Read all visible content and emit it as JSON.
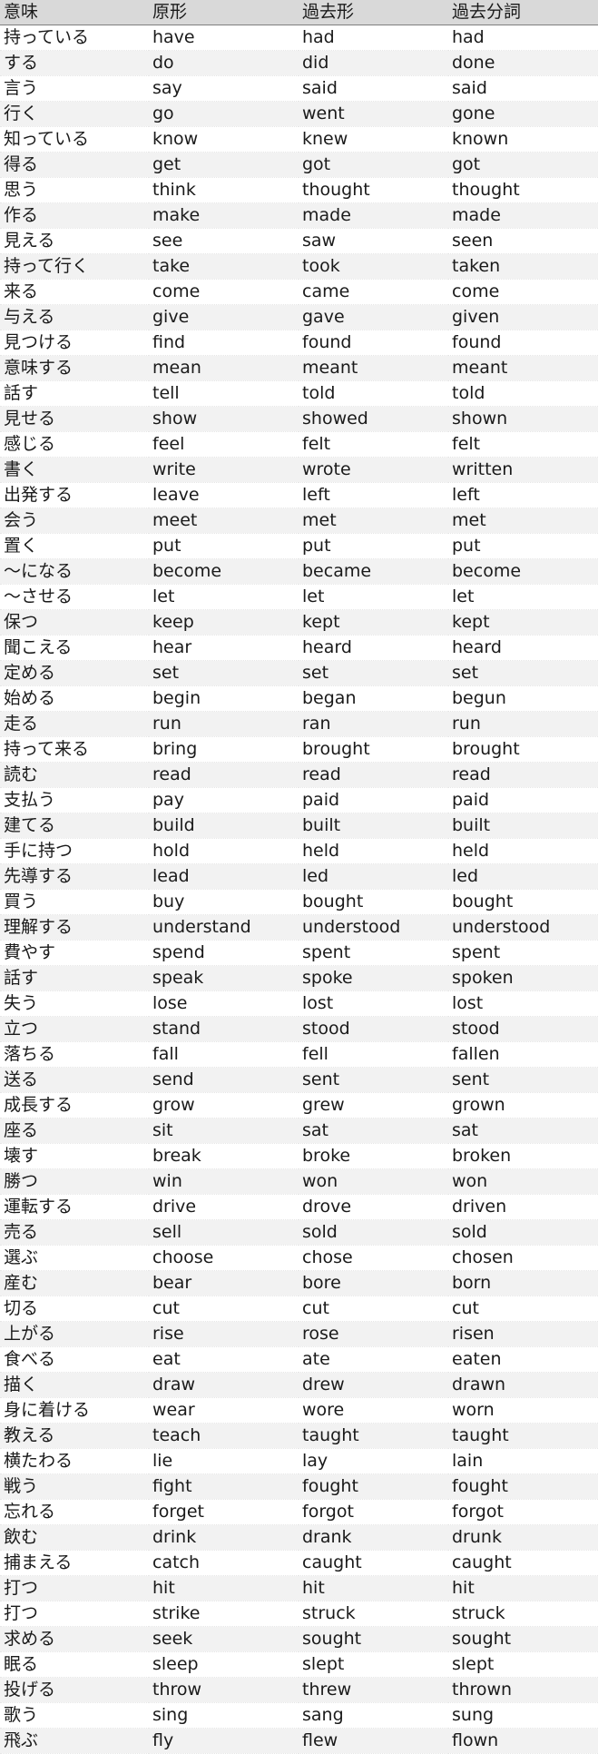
{
  "table": {
    "headers": [
      "意味",
      "原形",
      "過去形",
      "過去分詞"
    ],
    "rows": [
      [
        "持っている",
        "have",
        "had",
        "had"
      ],
      [
        "する",
        "do",
        "did",
        "done"
      ],
      [
        "言う",
        "say",
        "said",
        "said"
      ],
      [
        "行く",
        "go",
        "went",
        "gone"
      ],
      [
        "知っている",
        "know",
        "knew",
        "known"
      ],
      [
        "得る",
        "get",
        "got",
        "got"
      ],
      [
        "思う",
        "think",
        "thought",
        "thought"
      ],
      [
        "作る",
        "make",
        "made",
        "made"
      ],
      [
        "見える",
        "see",
        "saw",
        "seen"
      ],
      [
        "持って行く",
        "take",
        "took",
        "taken"
      ],
      [
        "来る",
        "come",
        "came",
        "come"
      ],
      [
        "与える",
        "give",
        "gave",
        "given"
      ],
      [
        "見つける",
        "find",
        "found",
        "found"
      ],
      [
        "意味する",
        "mean",
        "meant",
        "meant"
      ],
      [
        "話す",
        "tell",
        "told",
        "told"
      ],
      [
        "見せる",
        "show",
        "showed",
        "shown"
      ],
      [
        "感じる",
        "feel",
        "felt",
        "felt"
      ],
      [
        "書く",
        "write",
        "wrote",
        "written"
      ],
      [
        "出発する",
        "leave",
        "left",
        "left"
      ],
      [
        "会う",
        "meet",
        "met",
        "met"
      ],
      [
        "置く",
        "put",
        "put",
        "put"
      ],
      [
        "～になる",
        "become",
        "became",
        "become"
      ],
      [
        "～させる",
        "let",
        "let",
        "let"
      ],
      [
        "保つ",
        "keep",
        "kept",
        "kept"
      ],
      [
        "聞こえる",
        "hear",
        "heard",
        "heard"
      ],
      [
        "定める",
        "set",
        "set",
        "set"
      ],
      [
        "始める",
        "begin",
        "began",
        "begun"
      ],
      [
        "走る",
        "run",
        "ran",
        "run"
      ],
      [
        "持って来る",
        "bring",
        "brought",
        "brought"
      ],
      [
        "読む",
        "read",
        "read",
        "read"
      ],
      [
        "支払う",
        "pay",
        "paid",
        "paid"
      ],
      [
        "建てる",
        "build",
        "built",
        "built"
      ],
      [
        "手に持つ",
        "hold",
        "held",
        "held"
      ],
      [
        "先導する",
        "lead",
        "led",
        "led"
      ],
      [
        "買う",
        "buy",
        "bought",
        "bought"
      ],
      [
        "理解する",
        "understand",
        "understood",
        "understood"
      ],
      [
        "費やす",
        "spend",
        "spent",
        "spent"
      ],
      [
        "話す",
        "speak",
        "spoke",
        "spoken"
      ],
      [
        "失う",
        "lose",
        "lost",
        "lost"
      ],
      [
        "立つ",
        "stand",
        "stood",
        "stood"
      ],
      [
        "落ちる",
        "fall",
        "fell",
        "fallen"
      ],
      [
        "送る",
        "send",
        "sent",
        "sent"
      ],
      [
        "成長する",
        "grow",
        "grew",
        "grown"
      ],
      [
        "座る",
        "sit",
        "sat",
        "sat"
      ],
      [
        "壊す",
        "break",
        "broke",
        "broken"
      ],
      [
        "勝つ",
        "win",
        "won",
        "won"
      ],
      [
        "運転する",
        "drive",
        "drove",
        "driven"
      ],
      [
        "売る",
        "sell",
        "sold",
        "sold"
      ],
      [
        "選ぶ",
        "choose",
        "chose",
        "chosen"
      ],
      [
        "産む",
        "bear",
        "bore",
        "born"
      ],
      [
        "切る",
        "cut",
        "cut",
        "cut"
      ],
      [
        "上がる",
        "rise",
        "rose",
        "risen"
      ],
      [
        "食べる",
        "eat",
        "ate",
        "eaten"
      ],
      [
        "描く",
        "draw",
        "drew",
        "drawn"
      ],
      [
        "身に着ける",
        "wear",
        "wore",
        "worn"
      ],
      [
        "教える",
        "teach",
        "taught",
        "taught"
      ],
      [
        "横たわる",
        "lie",
        "lay",
        "lain"
      ],
      [
        "戦う",
        "fight",
        "fought",
        "fought"
      ],
      [
        "忘れる",
        "forget",
        "forgot",
        "forgot"
      ],
      [
        "飲む",
        "drink",
        "drank",
        "drunk"
      ],
      [
        "捕まえる",
        "catch",
        "caught",
        "caught"
      ],
      [
        "打つ",
        "hit",
        "hit",
        "hit"
      ],
      [
        "打つ",
        "strike",
        "struck",
        "struck"
      ],
      [
        "求める",
        "seek",
        "sought",
        "sought"
      ],
      [
        "眠る",
        "sleep",
        "slept",
        "slept"
      ],
      [
        "投げる",
        "throw",
        "threw",
        "thrown"
      ],
      [
        "歌う",
        "sing",
        "sang",
        "sung"
      ],
      [
        "飛ぶ",
        "fly",
        "flew",
        "flown"
      ]
    ]
  },
  "colors": {
    "header_bg": "#d9d9d9",
    "header_border": "#7f7f7f",
    "row_alt_bg": "#f2f2f2",
    "row_bg": "#ffffff",
    "text": "#1a1a1a"
  }
}
